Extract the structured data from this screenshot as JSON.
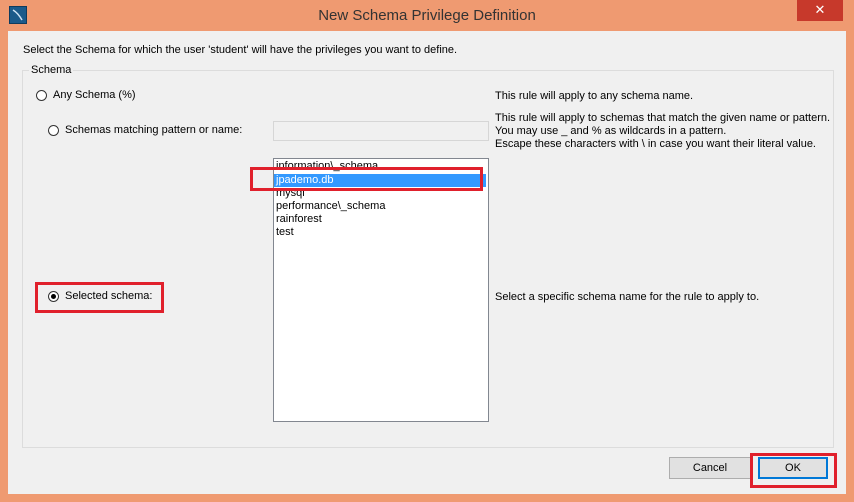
{
  "window": {
    "title": "New Schema Privilege Definition",
    "close_glyph": "✕"
  },
  "instruction": "Select the Schema for which the user 'student' will have the privileges you want to define.",
  "group": {
    "legend": "Schema",
    "options": [
      {
        "label": "Any Schema (%)",
        "checked": false
      },
      {
        "label": "Schemas matching pattern or name:",
        "checked": false
      },
      {
        "label": "Selected schema:",
        "checked": true
      }
    ],
    "descriptions": {
      "any": "This rule will apply to any schema name.",
      "pattern_1": "This rule will apply to schemas that match the given name or pattern.",
      "pattern_2": "You may use _ and % as wildcards in a pattern.",
      "pattern_3": "Escape these characters with \\ in case you want their literal value.",
      "selected": "Select a specific schema name for the rule to apply to."
    },
    "pattern_input_value": "",
    "schemas": [
      "information\\_schema",
      "jpademo.db",
      "mysql",
      "performance\\_schema",
      "rainforest",
      "test"
    ],
    "selected_schema": "jpademo.db"
  },
  "buttons": {
    "cancel": "Cancel",
    "ok": "OK"
  },
  "colors": {
    "frame": "#ef9a71",
    "highlight": "#e0202c",
    "selection": "#3399ff",
    "close": "#c7392b"
  }
}
